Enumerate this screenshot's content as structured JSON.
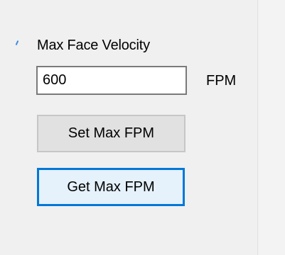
{
  "group": {
    "label": "Max Face Velocity"
  },
  "velocity_input": {
    "value": "600"
  },
  "unit": {
    "label": "FPM"
  },
  "buttons": {
    "set_label": "Set Max FPM",
    "get_label": "Get Max FPM"
  },
  "colors": {
    "background": "#f0f0f0",
    "focus_accent": "#0078d7",
    "button_face": "#e1e1e1"
  }
}
